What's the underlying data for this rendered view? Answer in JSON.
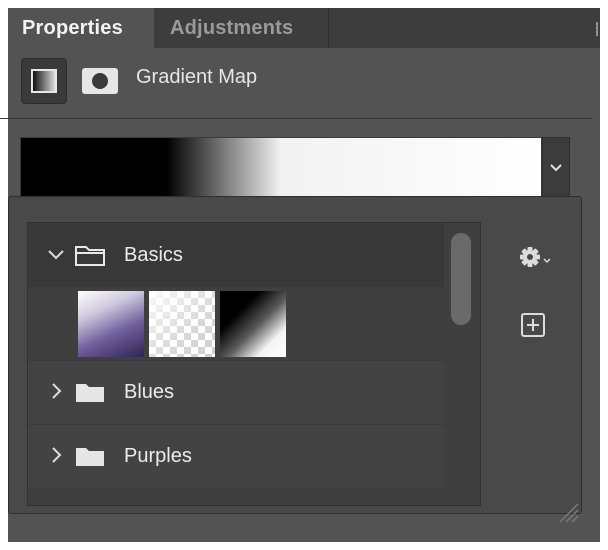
{
  "tabs": {
    "properties": "Properties",
    "adjustments": "Adjustments"
  },
  "header": {
    "title": "Gradient Map"
  },
  "gradient": {
    "colors": [
      "#000000",
      "#ffffff"
    ],
    "dropdown_icon": "chevron-down-icon"
  },
  "presets": {
    "groups": [
      {
        "label": "Basics",
        "expanded": true
      },
      {
        "label": "Blues",
        "expanded": false
      },
      {
        "label": "Purples",
        "expanded": false
      }
    ],
    "basics_swatches": [
      "purple-white-gradient",
      "transparent-gradient",
      "black-white-gradient"
    ]
  },
  "icons": {
    "settings": "gear-icon",
    "new_group": "add-box-icon",
    "resize": "resize-grip-icon"
  }
}
